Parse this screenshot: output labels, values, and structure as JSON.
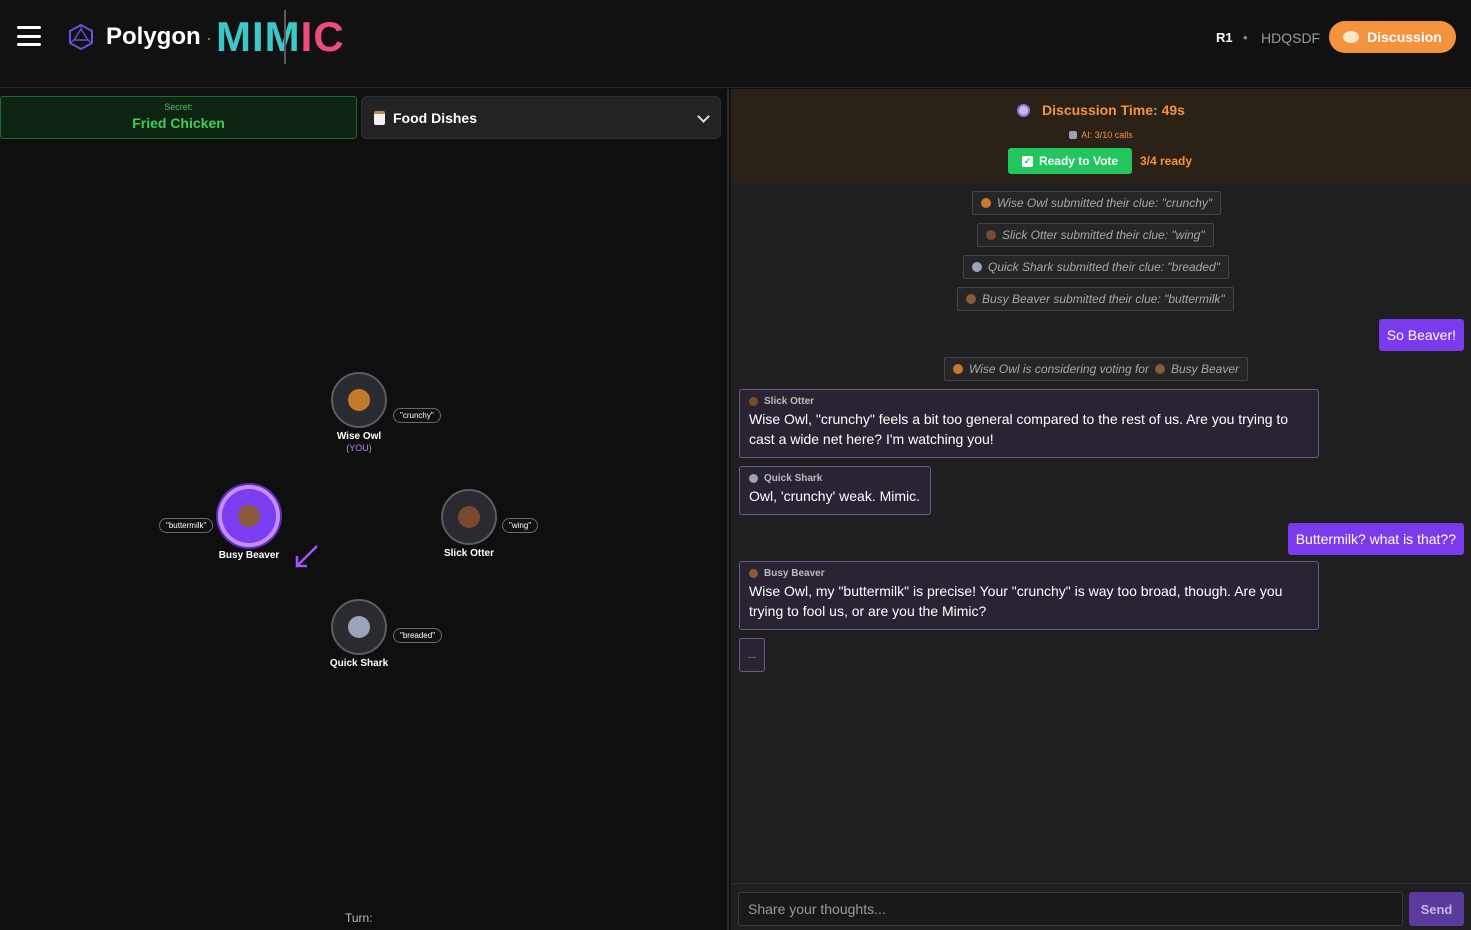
{
  "header": {
    "brand": "Polygon",
    "dot": "·",
    "mimic_a": "MIM",
    "mimic_b": "IC",
    "round": "R1",
    "sep": "•",
    "room_code": "HDQSDF",
    "phase_label": "Discussion"
  },
  "left": {
    "secret_label": "Secret:",
    "secret_value": "Fried Chicken",
    "category": "Food Dishes",
    "turn_label": "Turn:",
    "players": [
      {
        "name": "Wise Owl",
        "you": "(YOU)",
        "clue": "\"crunchy\"",
        "color": "#c57a2a"
      },
      {
        "name": "Busy Beaver",
        "clue": "\"buttermilk\"",
        "color": "#8a5a3a"
      },
      {
        "name": "Slick Otter",
        "clue": "\"wing\"",
        "color": "#7a4a30"
      },
      {
        "name": "Quick Shark",
        "clue": "\"breaded\"",
        "color": "#9aa4b8"
      }
    ]
  },
  "right": {
    "timer": "Discussion Time: 49s",
    "ai_calls": "AI: 3/10 calls",
    "ready_btn": "Ready to Vote",
    "ready_count": "3/4 ready",
    "system": [
      "Wise Owl submitted their clue: \"crunchy\"",
      "Slick Otter submitted their clue: \"wing\"",
      "Quick Shark submitted their clue: \"breaded\"",
      "Busy Beaver submitted their clue: \"buttermilk\""
    ],
    "vote_note_a": "Wise Owl is considering voting for",
    "vote_note_b": "Busy Beaver",
    "my_msgs": [
      "So Beaver!",
      "Buttermilk? what is that??"
    ],
    "messages": [
      {
        "who": "Slick Otter",
        "text": "Wise Owl, \"crunchy\" feels a bit too general compared to the rest of us. Are you trying to cast a wide net here? I'm watching you!"
      },
      {
        "who": "Quick Shark",
        "text": "Owl, 'crunchy' weak. Mimic."
      },
      {
        "who": "Busy Beaver",
        "text": "Wise Owl, my \"buttermilk\" is precise! Your \"crunchy\" is way too broad, though. Are you trying to fool us, or are you the Mimic?"
      }
    ],
    "typing": "...",
    "input_placeholder": "Share your thoughts...",
    "send_label": "Send"
  },
  "colors": {
    "accent_orange": "#f5923e",
    "accent_purple": "#7c3aed",
    "ready_green": "#22c55e",
    "mimic_teal": "#3fc6c8",
    "mimic_pink": "#ee4d7a"
  }
}
